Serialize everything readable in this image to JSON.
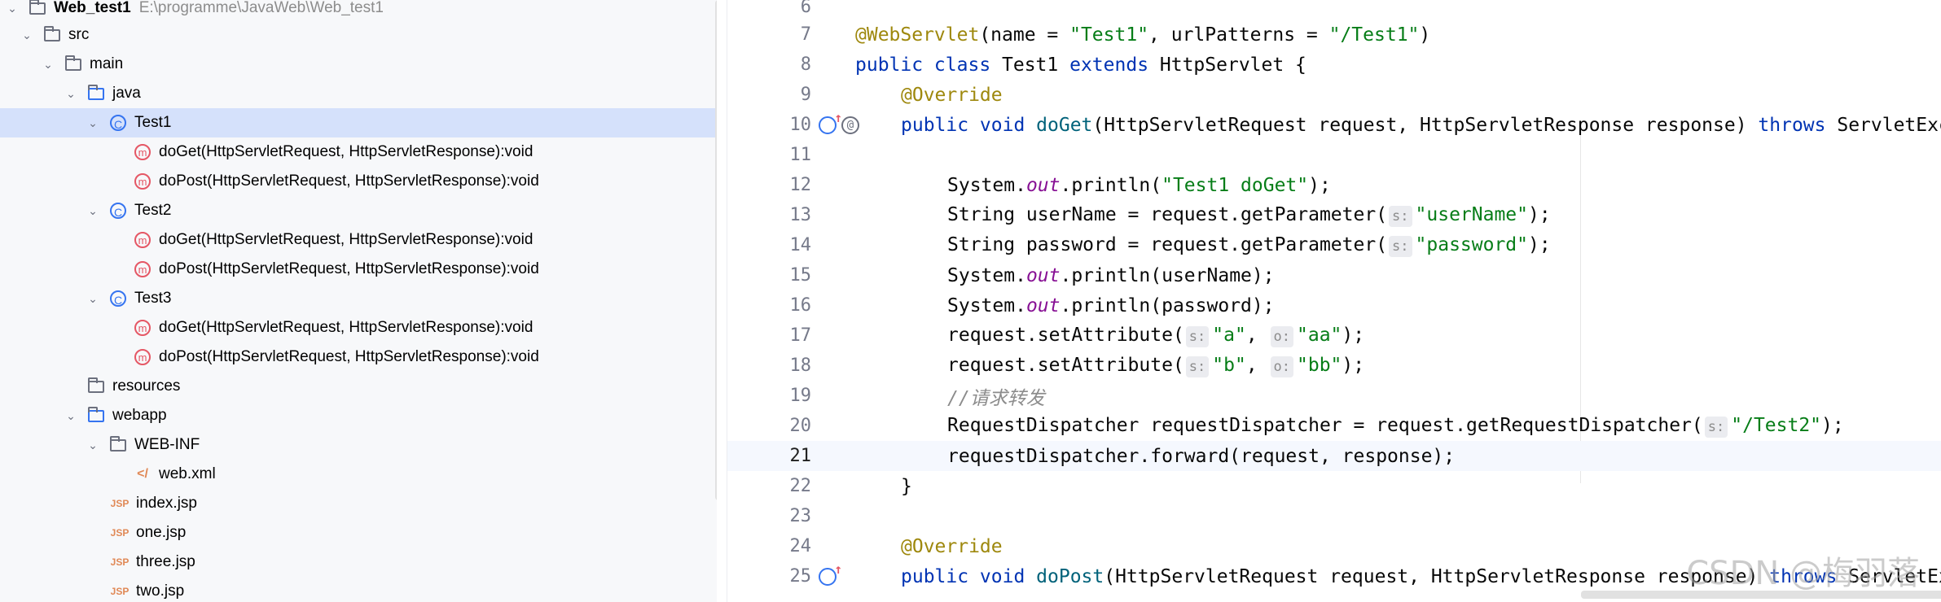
{
  "project": {
    "root_name": "Web_test1",
    "root_path": "E:\\programme\\JavaWeb\\Web_test1",
    "nodes": [
      {
        "label": "src",
        "type": "folder"
      },
      {
        "label": "main",
        "type": "folder"
      },
      {
        "label": "java",
        "type": "folder"
      },
      {
        "label": "Test1",
        "type": "class"
      },
      {
        "label": "doGet(HttpServletRequest, HttpServletResponse):void",
        "type": "method"
      },
      {
        "label": "doPost(HttpServletRequest, HttpServletResponse):void",
        "type": "method"
      },
      {
        "label": "Test2",
        "type": "class"
      },
      {
        "label": "doGet(HttpServletRequest, HttpServletResponse):void",
        "type": "method"
      },
      {
        "label": "doPost(HttpServletRequest, HttpServletResponse):void",
        "type": "method"
      },
      {
        "label": "Test3",
        "type": "class"
      },
      {
        "label": "doGet(HttpServletRequest, HttpServletResponse):void",
        "type": "method"
      },
      {
        "label": "doPost(HttpServletRequest, HttpServletResponse):void",
        "type": "method"
      },
      {
        "label": "resources",
        "type": "folder"
      },
      {
        "label": "webapp",
        "type": "folder"
      },
      {
        "label": "WEB-INF",
        "type": "folder"
      },
      {
        "label": "web.xml",
        "type": "xml"
      },
      {
        "label": "index.jsp",
        "type": "jsp"
      },
      {
        "label": "one.jsp",
        "type": "jsp"
      },
      {
        "label": "three.jsp",
        "type": "jsp"
      },
      {
        "label": "two.jsp",
        "type": "jsp"
      }
    ],
    "jsp_icon_text": "JSP"
  },
  "editor": {
    "line_numbers": [
      "6",
      "7",
      "8",
      "9",
      "10",
      "11",
      "12",
      "13",
      "14",
      "15",
      "16",
      "17",
      "18",
      "19",
      "20",
      "21",
      "22",
      "23",
      "24",
      "25"
    ],
    "current_line": "21",
    "hints": {
      "s": "s:",
      "o": "o:"
    },
    "tokens": {
      "l7_ann": "@WebServlet",
      "l7_a": "(name = ",
      "l7_s1": "\"Test1\"",
      "l7_b": ", urlPatterns = ",
      "l7_s2": "\"/Test1\"",
      "l7_c": ")",
      "l8_kw1": "public class ",
      "l8_a": "Test1 ",
      "l8_kw2": "extends ",
      "l8_b": "HttpServlet {",
      "l9_ann": "@Override",
      "l10_kw1": "public void ",
      "l10_fn": "doGet",
      "l10_a": "(HttpServletRequest request, HttpServletResponse response) ",
      "l10_kw2": "throws ",
      "l10_b": "ServletException",
      "l12_a": "System.",
      "l12_fld": "out",
      "l12_b": ".println(",
      "l12_s": "\"Test1 doGet\"",
      "l12_c": ");",
      "l13_a": "String userName = request.getParameter(",
      "l13_s": "\"userName\"",
      "l13_c": ");",
      "l14_a": "String password = request.getParameter(",
      "l14_s": "\"password\"",
      "l14_c": ");",
      "l15_a": "System.",
      "l15_fld": "out",
      "l15_b": ".println(userName);",
      "l16_a": "System.",
      "l16_fld": "out",
      "l16_b": ".println(password);",
      "l17_a": "request.setAttribute(",
      "l17_s1": "\"a\"",
      "l17_b": ", ",
      "l17_s2": "\"aa\"",
      "l17_c": ");",
      "l18_a": "request.setAttribute(",
      "l18_s1": "\"b\"",
      "l18_b": ", ",
      "l18_s2": "\"bb\"",
      "l18_c": ");",
      "l19_cmt": "//请求转发",
      "l20_a": "RequestDispatcher requestDispatcher = request.getRequestDispatcher(",
      "l20_s": "\"/Test2\"",
      "l20_c": ");",
      "l21_a": "requestDispatcher.forward(request, response);",
      "l22_a": "}",
      "l24_ann": "@Override",
      "l25_kw1": "public void ",
      "l25_fn": "doPost",
      "l25_a": "(HttpServletRequest request, HttpServletResponse response) ",
      "l25_kw2": "throws ",
      "l25_b": "ServletException"
    }
  },
  "watermark": "CSDN @梅羽落",
  "colors": {
    "keyword": "#0033b3",
    "string": "#067d17",
    "annotation": "#9e880d",
    "static_field": "#871094",
    "method_decl": "#00627a",
    "selection": "#d5e1fb"
  }
}
